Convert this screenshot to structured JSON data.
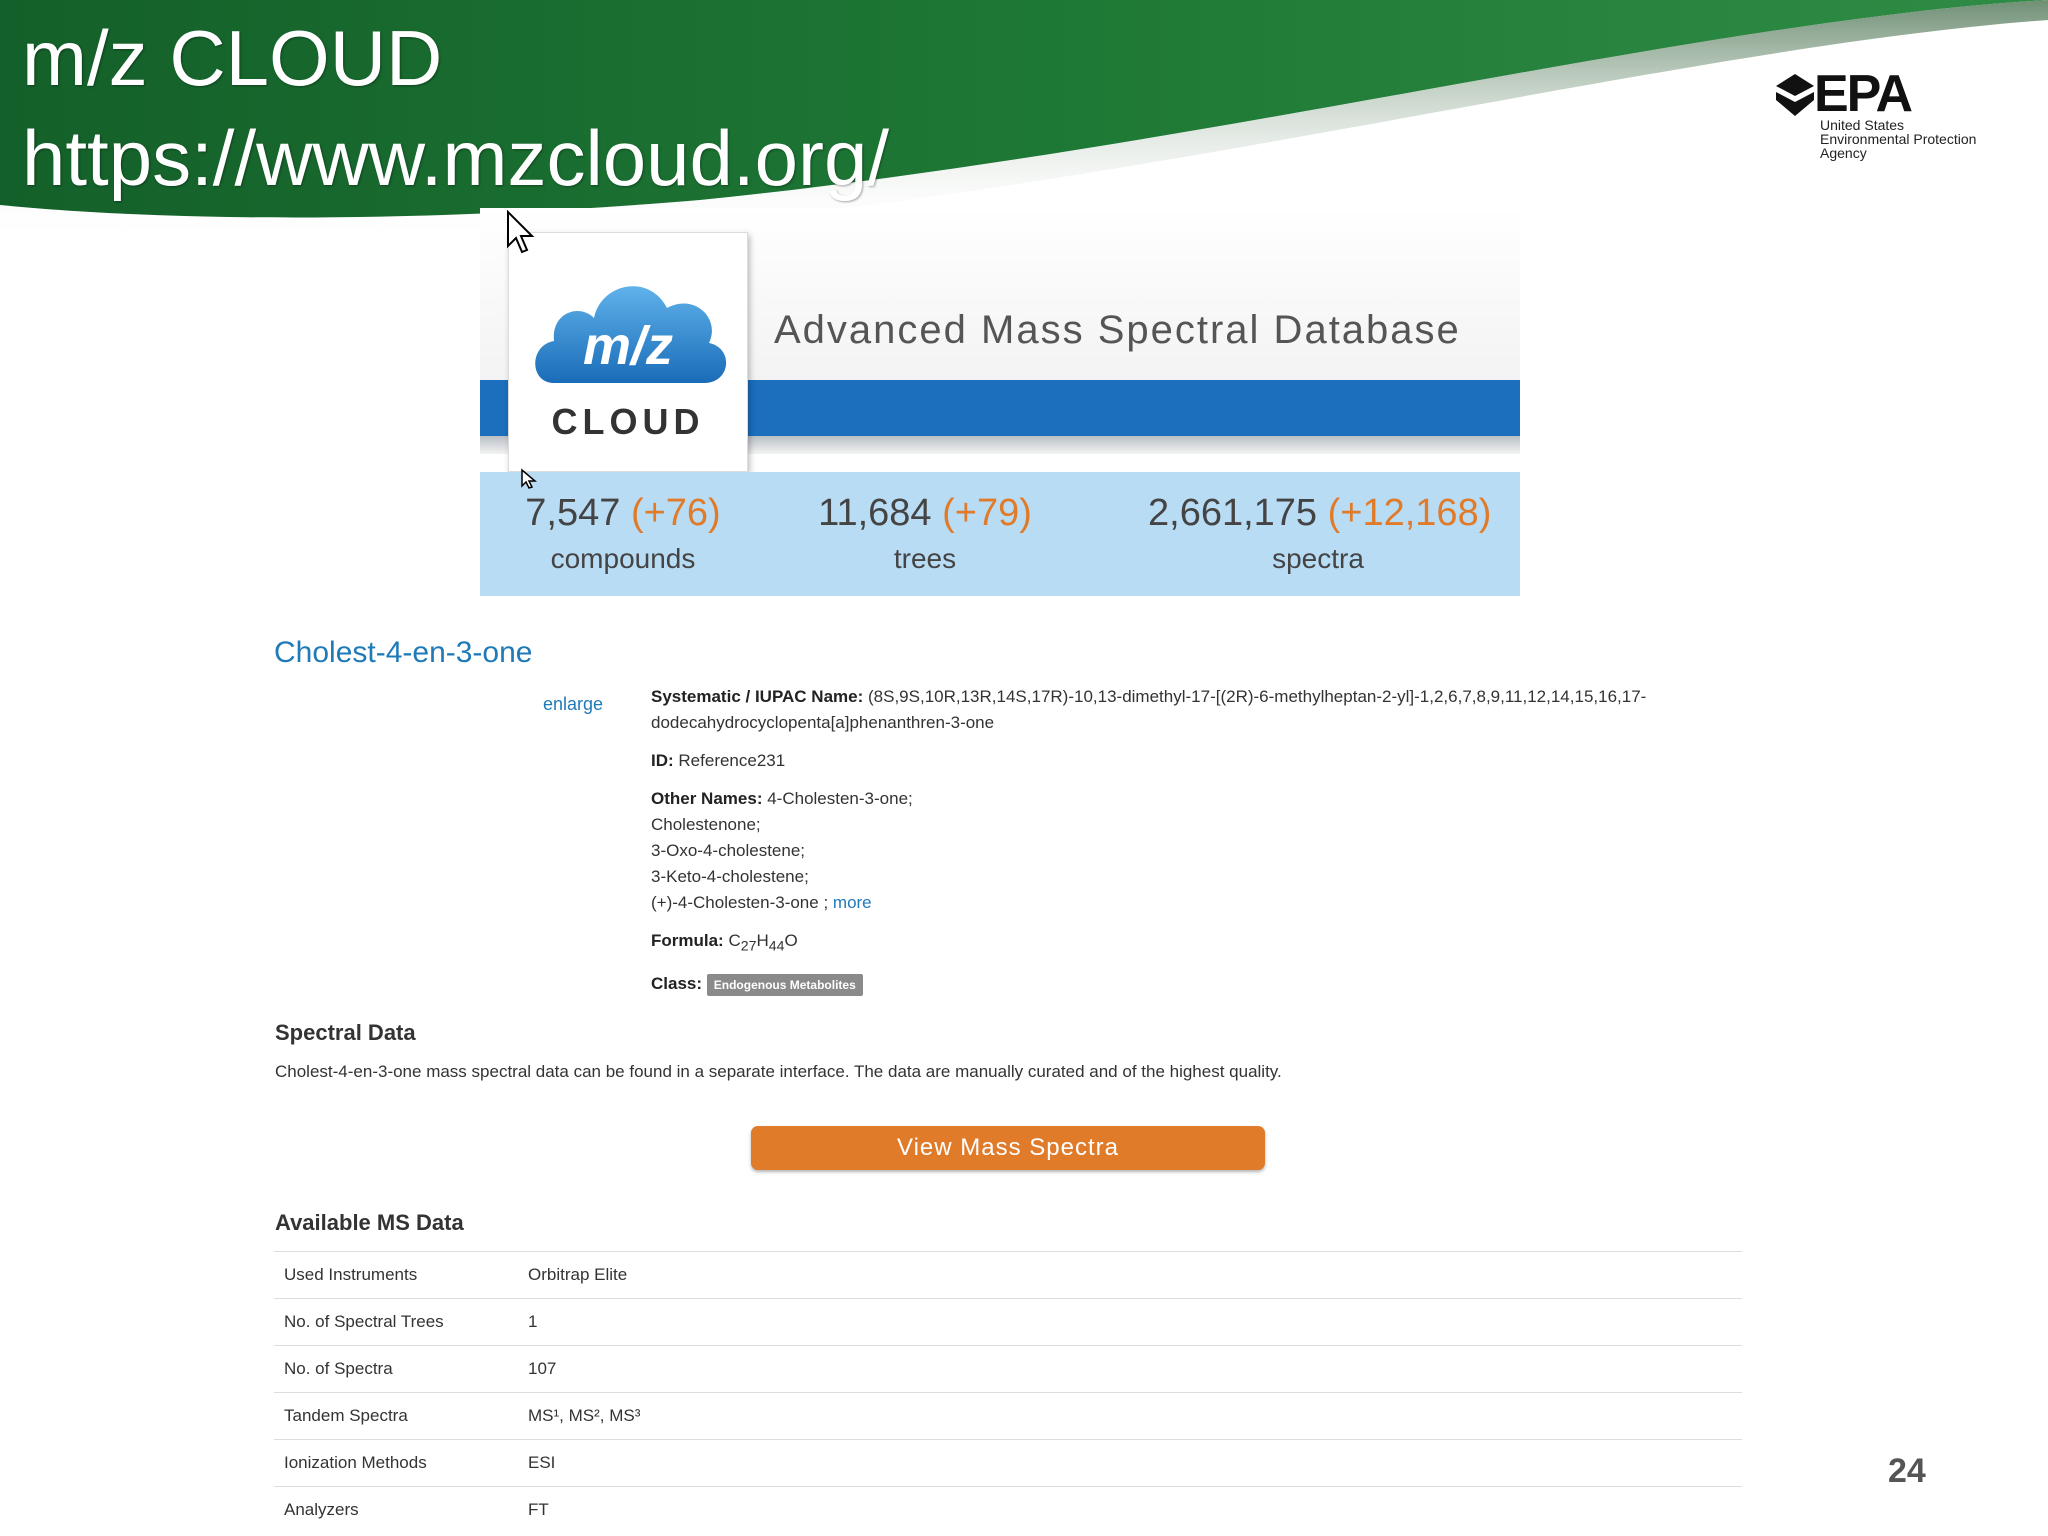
{
  "slide": {
    "title_line1": "m/z CLOUD",
    "title_line2": "https://www.mzcloud.org/",
    "page_number": "24",
    "epa": {
      "abbr": "EPA",
      "line1": "United States",
      "line2": "Environmental Protection",
      "line3": "Agency"
    }
  },
  "banner": {
    "logo_top": "m/z",
    "logo_bottom": "CLOUD",
    "tagline": "Advanced Mass Spectral Database",
    "stats": [
      {
        "value": "7,547",
        "delta": "(+76)",
        "label": "compounds"
      },
      {
        "value": "11,684",
        "delta": "(+79)",
        "label": "trees"
      },
      {
        "value": "2,661,175",
        "delta": "(+12,168)",
        "label": "spectra"
      }
    ]
  },
  "compound": {
    "name": "Cholest-4-en-3-one",
    "enlarge": "enlarge",
    "iupac_label": "Systematic / IUPAC Name:",
    "iupac_value": "(8S,9S,10R,13R,14S,17R)-10,13-dimethyl-17-[(2R)-6-methylheptan-2-yl]-1,2,6,7,8,9,11,12,14,15,16,17-dodecahydrocyclopenta[a]phenanthren-3-one",
    "id_label": "ID:",
    "id_value": "Reference231",
    "other_names_label": "Other Names:",
    "other_names": [
      "4-Cholesten-3-one;",
      "Cholestenone;",
      "3-Oxo-4-cholestene;",
      "3-Keto-4-cholestene;",
      "(+)-4-Cholesten-3-one ;"
    ],
    "more": "more",
    "formula_label": "Formula:",
    "formula": {
      "c": "C",
      "c_n": "27",
      "h": "H",
      "h_n": "44",
      "o": "O"
    },
    "class_label": "Class:",
    "class_value": "Endogenous Metabolites"
  },
  "spectral": {
    "heading": "Spectral Data",
    "description": "Cholest-4-en-3-one mass spectral data can be found in a separate interface. The data are manually curated and of the highest quality.",
    "button": "View Mass Spectra"
  },
  "ms_data": {
    "heading": "Available MS Data",
    "rows": [
      {
        "key": "Used Instruments",
        "value": "Orbitrap Elite"
      },
      {
        "key": "No. of Spectral Trees",
        "value": "1"
      },
      {
        "key": "No. of Spectra",
        "value": "107"
      },
      {
        "key": "Tandem Spectra",
        "value": "MS¹, MS², MS³"
      },
      {
        "key": "Ionization Methods",
        "value": "ESI"
      },
      {
        "key": "Analyzers",
        "value": "FT"
      }
    ]
  },
  "colors": {
    "header_green": "#1e6e34",
    "banner_blue": "#1b6fbd",
    "stats_bg": "#b9dcf5",
    "accent_orange": "#e07b2a",
    "link_blue": "#1f7ab8"
  }
}
